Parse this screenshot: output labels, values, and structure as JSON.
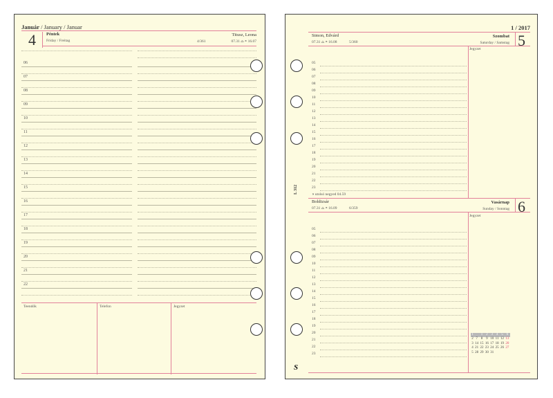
{
  "left": {
    "month_hu": "Január",
    "month_rest": " / January / Januar",
    "day_number": "4",
    "weekday": "Péntek",
    "weekday_translations": "Friday / Freitag",
    "name_days": "Titusz, Leona",
    "day_of_year": "4/361",
    "sun_times": "07.31 ⌓ ◓ 16.07",
    "hours": [
      "06",
      "07",
      "08",
      "09",
      "10",
      "11",
      "12",
      "13",
      "14",
      "15",
      "16",
      "17",
      "18",
      "19",
      "20",
      "21",
      "22"
    ],
    "footer": {
      "col1": "Teendők",
      "col2": "Telefon",
      "col3": "Jegyzet"
    }
  },
  "right": {
    "page_ref": "1 / 2017",
    "top": {
      "name_days": "Simon, Edvárd",
      "sun_times": "07.31 ⌓ ◓ 16.08",
      "day_of_year": "5/360",
      "weekday": "Szombat",
      "weekday_translations": "Saturday / Samstag",
      "day_number": "5",
      "notes_label": "Jegyzet",
      "hours": [
        "05",
        "06",
        "07",
        "08",
        "09",
        "10",
        "11",
        "12",
        "13",
        "14",
        "15",
        "16",
        "17",
        "18",
        "19",
        "20",
        "21",
        "22",
        "23"
      ],
      "moon_note": "◑ utolsó negyed 04.59"
    },
    "bottom": {
      "name_days": "Boldizsár",
      "sun_times": "07.31 ⌓ ◓ 16.09",
      "day_of_year": "6/359",
      "weekday": "Vasárnap",
      "weekday_translations": "Sunday / Sonntag",
      "day_number": "6",
      "notes_label": "Jegyzet",
      "hours": [
        "05",
        "06",
        "07",
        "08",
        "09",
        "10",
        "11",
        "12",
        "13",
        "14",
        "15",
        "16",
        "17",
        "18",
        "19",
        "20",
        "21",
        "22",
        "23"
      ]
    },
    "side_code": "L 312",
    "logo": "S",
    "mini_calendar": {
      "header": [
        "1",
        "",
        "1",
        "2",
        "3",
        "4",
        "5",
        "6"
      ],
      "rows": [
        [
          "2",
          "7",
          "8",
          "9",
          "10",
          "11",
          "12",
          "13"
        ],
        [
          "3",
          "14",
          "15",
          "16",
          "17",
          "18",
          "19",
          "20"
        ],
        [
          "4",
          "21",
          "22",
          "23",
          "24",
          "25",
          "26",
          "27"
        ],
        [
          "5",
          "28",
          "29",
          "30",
          "31",
          "",
          "",
          ""
        ]
      ]
    }
  }
}
